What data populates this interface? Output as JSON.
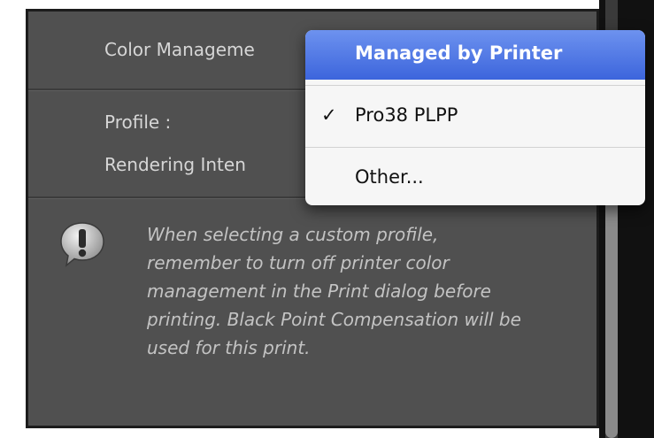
{
  "panel": {
    "color_management_label": "Color Manageme",
    "profile_label": "Profile :",
    "rendering_intent_label": "Rendering Inten",
    "note_text": "When selecting a custom profile, remember to turn off printer color management in the Print dialog before printing. Black Point Compensation will be used for this print."
  },
  "dropdown": {
    "items": [
      {
        "label": "Managed by Printer",
        "highlighted": true,
        "checked": false
      },
      {
        "label": "Pro38 PLPP",
        "highlighted": false,
        "checked": true
      },
      {
        "label": "Other...",
        "highlighted": false,
        "checked": false
      }
    ],
    "check_mark": "✓"
  },
  "colors": {
    "panel_bg": "#505050",
    "highlight": "#3c65dc",
    "menu_bg": "#f6f6f6"
  },
  "icons": {
    "warning": "exclamation-bubble-icon"
  }
}
